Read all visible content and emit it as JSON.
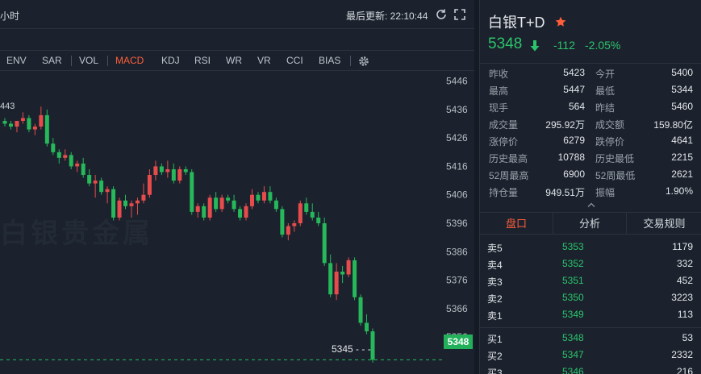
{
  "chart": {
    "period_label": "小时",
    "update_text": "最后更新: 22:10:44",
    "indicators": [
      "ENV",
      "SAR",
      "VOL",
      "MACD",
      "KDJ",
      "RSI",
      "WR",
      "VR",
      "CCI",
      "BIAS"
    ],
    "active_indicator": "MACD",
    "partial_price_label": "443",
    "watermark": "白银贵金属",
    "last_price_tag": "5348",
    "low_tag": "5345",
    "y_ticks": [
      "5446",
      "5436",
      "5426",
      "5416",
      "5406",
      "5396",
      "5386",
      "5376",
      "5366",
      "5356"
    ],
    "up_color": "#e74c4c",
    "down_color": "#26b85a"
  },
  "chart_data": {
    "type": "candlestick",
    "ylim": [
      5343,
      5449
    ],
    "candles": [
      [
        5432,
        5433,
        5430,
        5431
      ],
      [
        5431,
        5432,
        5429,
        5430
      ],
      [
        5430,
        5432,
        5428,
        5432
      ],
      [
        5432,
        5435,
        5431,
        5433
      ],
      [
        5433,
        5434,
        5428,
        5429
      ],
      [
        5429,
        5431,
        5427,
        5430
      ],
      [
        5430,
        5437,
        5429,
        5434
      ],
      [
        5434,
        5436,
        5423,
        5424
      ],
      [
        5424,
        5426,
        5420,
        5421
      ],
      [
        5421,
        5422,
        5417,
        5419
      ],
      [
        5419,
        5422,
        5418,
        5420
      ],
      [
        5420,
        5421,
        5415,
        5416
      ],
      [
        5416,
        5418,
        5414,
        5417
      ],
      [
        5417,
        5419,
        5412,
        5413
      ],
      [
        5413,
        5415,
        5409,
        5410
      ],
      [
        5410,
        5413,
        5405,
        5411
      ],
      [
        5411,
        5412,
        5406,
        5407
      ],
      [
        5407,
        5409,
        5403,
        5408
      ],
      [
        5408,
        5409,
        5397,
        5398
      ],
      [
        5398,
        5405,
        5397,
        5404
      ],
      [
        5404,
        5406,
        5401,
        5402
      ],
      [
        5402,
        5404,
        5398,
        5403
      ],
      [
        5403,
        5405,
        5399,
        5404
      ],
      [
        5404,
        5410,
        5403,
        5406
      ],
      [
        5406,
        5415,
        5405,
        5413
      ],
      [
        5413,
        5418,
        5411,
        5416
      ],
      [
        5416,
        5417,
        5413,
        5414
      ],
      [
        5414,
        5418,
        5412,
        5415
      ],
      [
        5415,
        5417,
        5410,
        5411
      ],
      [
        5411,
        5416,
        5410,
        5415
      ],
      [
        5415,
        5416,
        5413,
        5414
      ],
      [
        5414,
        5415,
        5399,
        5400
      ],
      [
        5400,
        5403,
        5398,
        5402
      ],
      [
        5402,
        5403,
        5397,
        5398
      ],
      [
        5398,
        5406,
        5397,
        5405
      ],
      [
        5405,
        5407,
        5400,
        5401
      ],
      [
        5401,
        5406,
        5400,
        5405
      ],
      [
        5405,
        5406,
        5403,
        5404
      ],
      [
        5404,
        5406,
        5400,
        5401
      ],
      [
        5401,
        5402,
        5397,
        5398
      ],
      [
        5398,
        5403,
        5397,
        5402
      ],
      [
        5402,
        5408,
        5401,
        5406
      ],
      [
        5406,
        5407,
        5403,
        5404
      ],
      [
        5404,
        5409,
        5403,
        5407
      ],
      [
        5407,
        5409,
        5403,
        5404
      ],
      [
        5404,
        5405,
        5400,
        5401
      ],
      [
        5401,
        5402,
        5391,
        5392
      ],
      [
        5392,
        5396,
        5390,
        5395
      ],
      [
        5395,
        5397,
        5393,
        5396
      ],
      [
        5396,
        5404,
        5395,
        5403
      ],
      [
        5403,
        5405,
        5399,
        5400
      ],
      [
        5400,
        5403,
        5397,
        5398
      ],
      [
        5398,
        5400,
        5395,
        5396
      ],
      [
        5396,
        5398,
        5381,
        5382
      ],
      [
        5382,
        5385,
        5370,
        5371
      ],
      [
        5371,
        5382,
        5369,
        5379
      ],
      [
        5379,
        5381,
        5375,
        5378
      ],
      [
        5378,
        5384,
        5377,
        5383
      ],
      [
        5383,
        5384,
        5369,
        5370
      ],
      [
        5370,
        5371,
        5360,
        5361
      ],
      [
        5361,
        5364,
        5357,
        5358
      ],
      [
        5358,
        5359,
        5347,
        5348
      ]
    ]
  },
  "symbol": {
    "name": "白银T+D",
    "last": "5348",
    "change": "-112",
    "change_pct": "-2.05%"
  },
  "stats": [
    {
      "l_label": "昨收",
      "l_value": "5423",
      "r_label": "今开",
      "r_value": "5400"
    },
    {
      "l_label": "最高",
      "l_value": "5447",
      "r_label": "最低",
      "r_value": "5344"
    },
    {
      "l_label": "现手",
      "l_value": "564",
      "r_label": "昨结",
      "r_value": "5460"
    },
    {
      "l_label": "成交量",
      "l_value": "295.92万",
      "r_label": "成交额",
      "r_value": "159.80亿"
    },
    {
      "l_label": "涨停价",
      "l_value": "6279",
      "r_label": "跌停价",
      "r_value": "4641"
    },
    {
      "l_label": "历史最高",
      "l_value": "10788",
      "r_label": "历史最低",
      "r_value": "2215"
    },
    {
      "l_label": "52周最高",
      "l_value": "6900",
      "r_label": "52周最低",
      "r_value": "2621"
    },
    {
      "l_label": "持仓量",
      "l_value": "949.51万",
      "r_label": "振幅",
      "r_value": "1.90%"
    }
  ],
  "tabs": [
    "盘口",
    "分析",
    "交易规则"
  ],
  "order_book": {
    "asks": [
      {
        "label": "卖5",
        "price": "5353",
        "vol": "1179"
      },
      {
        "label": "卖4",
        "price": "5352",
        "vol": "332"
      },
      {
        "label": "卖3",
        "price": "5351",
        "vol": "452"
      },
      {
        "label": "卖2",
        "price": "5350",
        "vol": "3223"
      },
      {
        "label": "卖1",
        "price": "5349",
        "vol": "113"
      }
    ],
    "bids": [
      {
        "label": "买1",
        "price": "5348",
        "vol": "53"
      },
      {
        "label": "买2",
        "price": "5347",
        "vol": "2332"
      },
      {
        "label": "买3",
        "price": "5346",
        "vol": "216"
      }
    ]
  }
}
